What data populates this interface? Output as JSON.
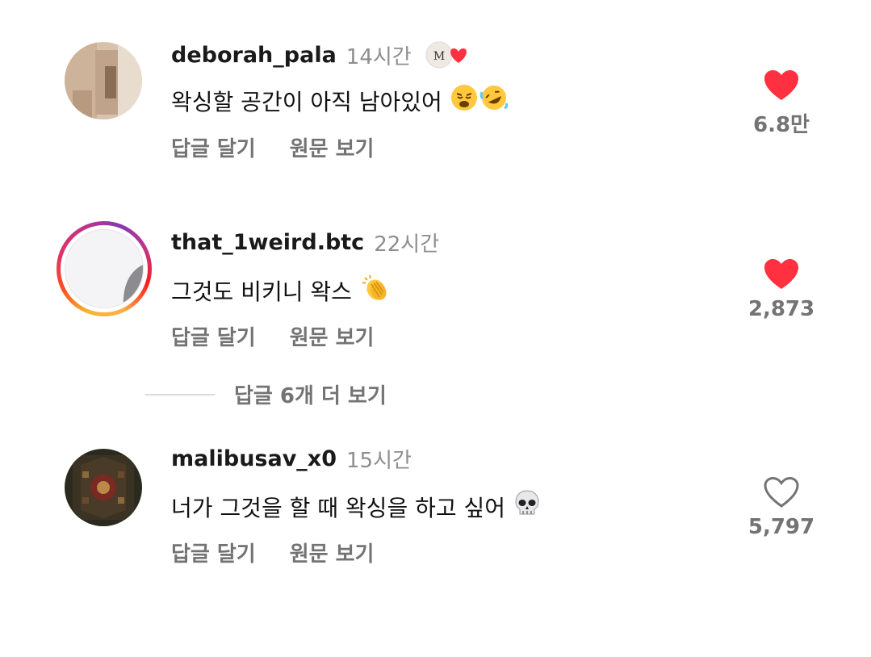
{
  "comments": [
    {
      "username": "deborah_pala",
      "time": "14시간",
      "text": "왁싱할 공간이 아직 남아있어",
      "emoji": [
        "weary-face",
        "rolling-on-floor-laughing"
      ],
      "creator_liked": true,
      "reply_label": "답글 달기",
      "translate_label": "원문 보기",
      "like_count": "6.8만",
      "liked": true
    },
    {
      "username": "that_1weird.btc",
      "time": "22시간",
      "text": "그것도 비키니 왁스",
      "emoji": [
        "clapping-hands"
      ],
      "has_story_ring": true,
      "reply_label": "답글 달기",
      "translate_label": "원문 보기",
      "like_count": "2,873",
      "liked": true
    },
    {
      "username": "malibusav_x0",
      "time": "15시간",
      "text": "너가 그것을 할 때 왁싱을 하고 싶어",
      "emoji": [
        "skull"
      ],
      "reply_label": "답글 달기",
      "translate_label": "원문 보기",
      "like_count": "5,797",
      "liked": false
    }
  ],
  "more_replies_label": "답글 6개 더 보기",
  "colors": {
    "like_red": "#ff3040",
    "secondary_text": "#737373",
    "time_text": "#8e8e8e"
  }
}
